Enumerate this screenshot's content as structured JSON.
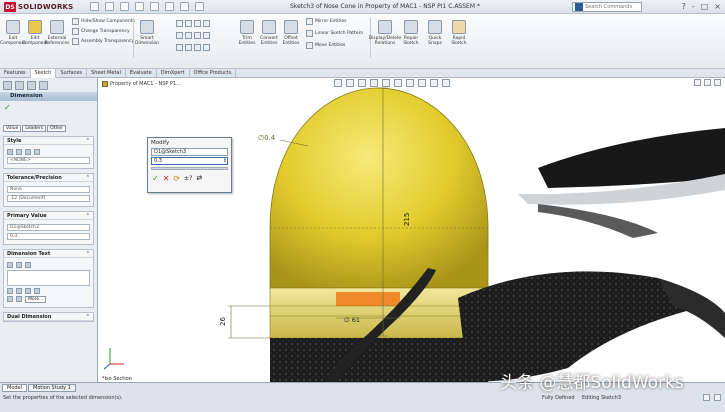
{
  "titlebar": {
    "logo_badge": "DS",
    "logo_text": "SOLIDWORKS",
    "document_title": "Sketch3 of Nose Cone  in Property of MAC1 - NSP PI1 C.ASSEM *",
    "search_placeholder": "Search Commands",
    "window_controls": [
      "?",
      "-",
      "□",
      "×"
    ]
  },
  "ribbon": {
    "big_buttons": [
      "Exit Component",
      "Edit Component",
      "External References",
      "Smart Dimension"
    ],
    "small_rows": [
      "Hide/Show Components",
      "Change Transparency",
      "Assembly Transparency"
    ],
    "tools": [
      "Trim Entities",
      "Convert Entities",
      "Offset Entities",
      "Mirror Entities",
      "Linear Sketch Pattern",
      "Move Entities",
      "Display/Delete Relations",
      "Repair Sketch",
      "Quick Snaps",
      "Rapid Sketch"
    ]
  },
  "command_tabs": [
    "Features",
    "Sketch",
    "Surfaces",
    "Sheet Metal",
    "Evaluate",
    "DimXpert",
    "Office Products"
  ],
  "left_panel": {
    "title": "Dimension",
    "sub_tabs": [
      "Value",
      "Leaders",
      "Other"
    ],
    "groups": {
      "style": {
        "title": "Style",
        "select": "<NONE>"
      },
      "tolerance": {
        "title": "Tolerance/Precision",
        "tolerance_select": "None",
        "precision_select": ".12 (Document)"
      },
      "primary_value": {
        "title": "Primary Value",
        "name": "D1@Sketch3",
        "value": "0.3"
      },
      "dimension_text": {
        "title": "Dimension Text",
        "more_label": "More..."
      },
      "dual_dimension": {
        "title": "Dual Dimension"
      }
    }
  },
  "viewport": {
    "tree_flyout": "Property of MAC1 - NSP P1...",
    "view_label": "*Iso Section",
    "dimensions": {
      "height": "215",
      "radius": "∅0.4",
      "band": "26",
      "diameter": "∅ 61"
    }
  },
  "modify_dialog": {
    "title": "Modify",
    "dimension_name": "D1@Sketch3",
    "value": "0.3",
    "buttons": [
      "ok",
      "cancel",
      "rebuild",
      "mark",
      "reverse"
    ]
  },
  "statusbar": {
    "tabs": [
      "Model",
      "Motion Study 1"
    ],
    "hint": "Set the properties of the selected dimension(s).",
    "state1": "Fully Defined",
    "state2": "Editing Sketch3"
  },
  "watermark": "头条 @慧都SolidWorks",
  "colors": {
    "cone_yellow": "#e8d43a",
    "dimension_line": "#6d6a2a",
    "band_orange": "#f07a1a",
    "blade_black": "#1d1d1d"
  }
}
